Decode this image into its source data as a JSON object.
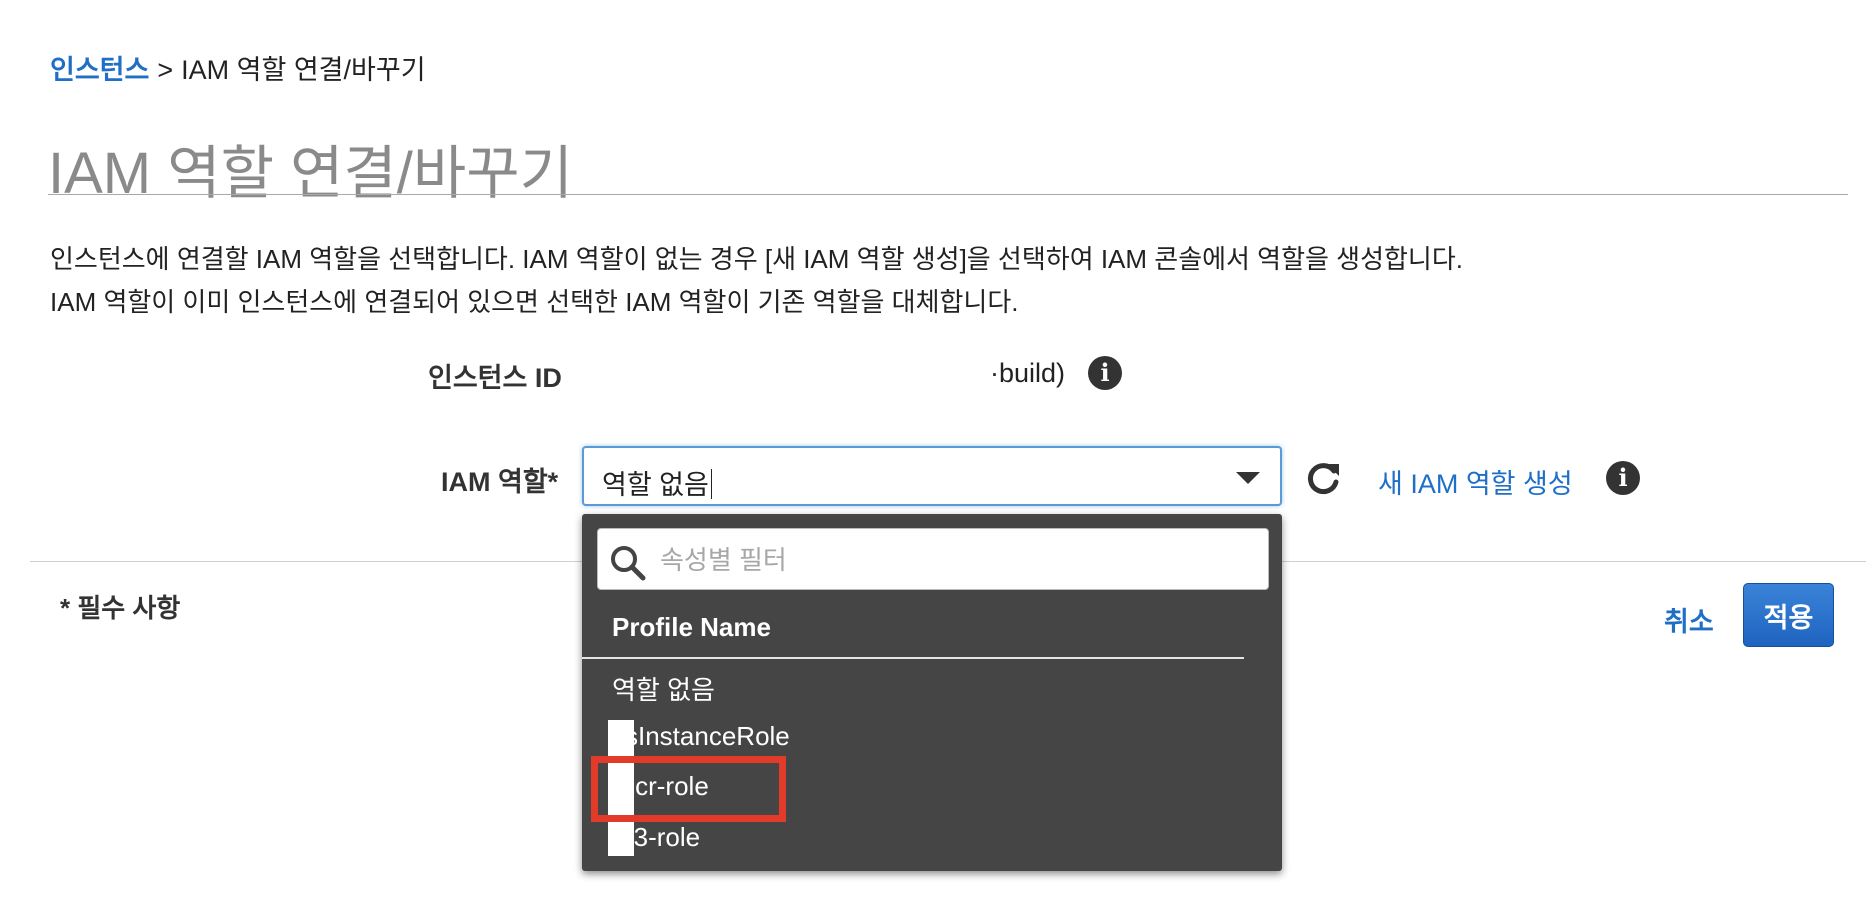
{
  "breadcrumb": {
    "link_label": "인스턴스",
    "separator": ">",
    "current": "IAM 역할 연결/바꾸기"
  },
  "page_title": "IAM 역할 연결/바꾸기",
  "description": {
    "line1": "인스턴스에 연결할 IAM 역할을 선택합니다. IAM 역할이 없는 경우 [새 IAM 역할 생성]을 선택하여 IAM 콘솔에서 역할을 생성합니다.",
    "line2": "IAM 역할이 이미 인스턴스에 연결되어 있으면 선택한 IAM 역할이 기존 역할을 대체합니다."
  },
  "form": {
    "instance_id_label": "인스턴스 ID",
    "instance_id_value": "·build)",
    "iam_role_label": "IAM 역할*",
    "iam_role_value": "역할 없음",
    "new_role_link": "새 IAM 역할 생성"
  },
  "icons": {
    "info": "info-icon",
    "refresh": "refresh-icon",
    "search": "search-icon",
    "dropdown_arrow": "chevron-down-icon"
  },
  "dropdown": {
    "filter_placeholder": "속성별 필터",
    "column_header": "Profile Name",
    "options": [
      "역할 없음",
      "csInstanceRole",
      "-ecr-role",
      "-s3-role"
    ],
    "highlighted_option": "-ecr-role"
  },
  "footer": {
    "required_note": "* 필수 사항",
    "cancel_label": "취소",
    "apply_label": "적용"
  },
  "colors": {
    "link": "#1f6fc7",
    "primary_button": "#1e64c0",
    "dropdown_bg": "#454545",
    "highlight": "#e33b2a"
  }
}
